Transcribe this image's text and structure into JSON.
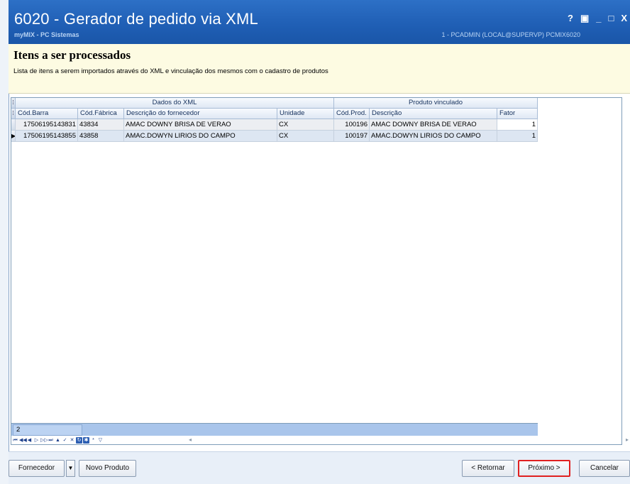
{
  "window": {
    "title": "6020 - Gerador de pedido via XML",
    "subtitle": "myMIX - PC Sistemas",
    "userinfo": "1 - PCADMIN (LOCAL@SUPERVP)   PCMIX6020",
    "buttons": {
      "help": "?",
      "restore": "▣",
      "minimize": "_",
      "maximize": "□",
      "close": "X"
    }
  },
  "header": {
    "title": "Itens a ser processados",
    "description": "Lista de itens a serem importados através do XML e vinculação dos mesmos com o cadastro de produtos"
  },
  "grid": {
    "bands": {
      "xml": "Dados do XML",
      "produto": "Produto vinculado"
    },
    "columns": [
      "Cód.Barra",
      "Cód.Fábrica",
      "Descrição do fornecedor",
      "Unidade",
      "Cód.Prod.",
      "Descrição",
      "Fator"
    ],
    "rows": [
      {
        "cod_barra": "17506195143831",
        "cod_fabrica": "43834",
        "descricao_fornecedor": "AMAC DOWNY BRISA DE VERAO",
        "unidade": "CX",
        "cod_prod": "100196",
        "descricao": "AMAC DOWNY BRISA DE VERAO",
        "fator": "1"
      },
      {
        "cod_barra": "17506195143855",
        "cod_fabrica": "43858",
        "descricao_fornecedor": "AMAC.DOWYN LIRIOS DO CAMPO",
        "unidade": "CX",
        "cod_prod": "100197",
        "descricao": "AMAC.DOWYN LIRIOS DO CAMPO",
        "fator": "1"
      }
    ],
    "selected_row": 1,
    "footer_count": "2"
  },
  "buttons": {
    "fornecedor": "Fornecedor",
    "novo_produto": "Novo Produto",
    "retornar": "< Retornar",
    "proximo": "Próximo >",
    "cancelar": "Cancelar"
  },
  "colors": {
    "titlebar": "#1f5eb4",
    "header_bg": "#fdfbe2",
    "focus_border": "#e02020",
    "footer_band": "#a9c5eb"
  }
}
